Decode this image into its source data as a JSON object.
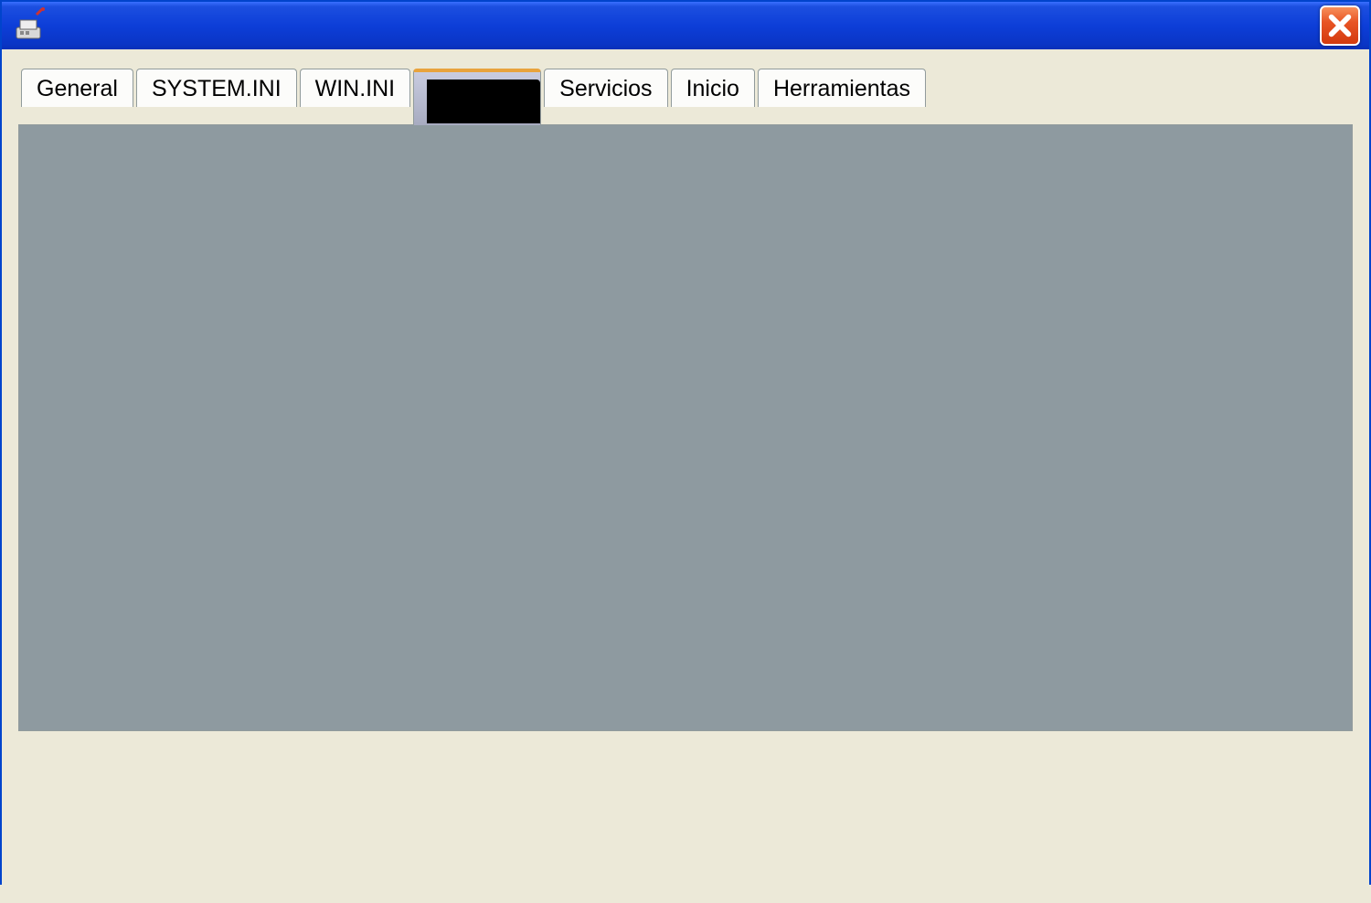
{
  "window": {
    "title": ""
  },
  "tabs": [
    {
      "label": "General",
      "active": false
    },
    {
      "label": "SYSTEM.INI",
      "active": false
    },
    {
      "label": "WIN.INI",
      "active": false
    },
    {
      "label": "",
      "active": true,
      "redacted": true
    },
    {
      "label": "Servicios",
      "active": false
    },
    {
      "label": "Inicio",
      "active": false
    },
    {
      "label": "Herramientas",
      "active": false
    }
  ],
  "icons": {
    "close": "close-icon",
    "app": "msconfig-icon"
  },
  "colors": {
    "titlebar_start": "#3a6fff",
    "titlebar_end": "#0830b8",
    "client_bg": "#ece9d8",
    "content_bg": "#8e9aa0",
    "close_bg": "#e85525",
    "active_tab_accent": "#e8a33d"
  }
}
